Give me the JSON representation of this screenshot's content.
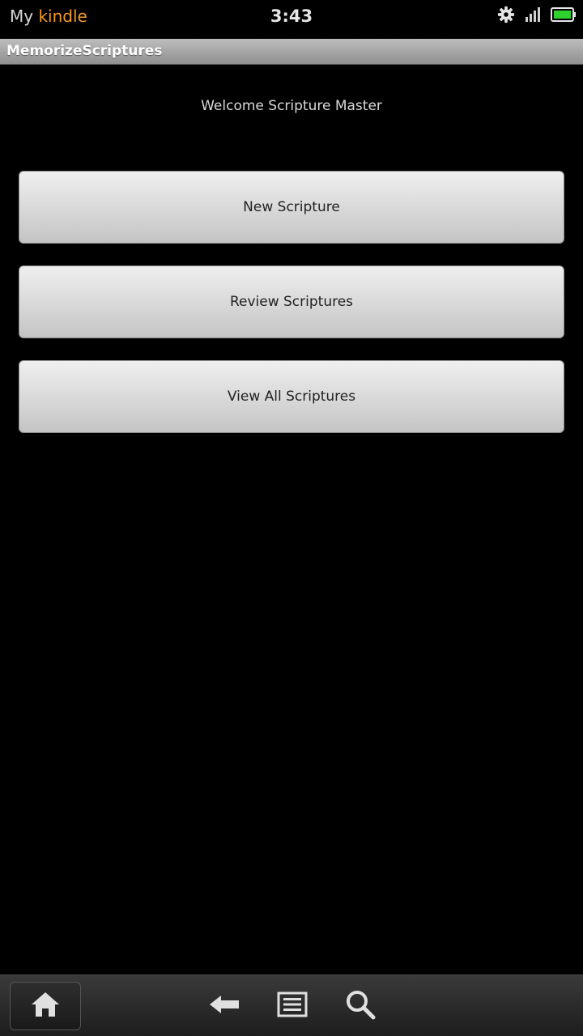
{
  "status_bar": {
    "brand_prefix": "My",
    "brand_name": "kindle",
    "time": "3:43",
    "icons": [
      "gear-icon",
      "signal-icon",
      "battery-icon"
    ],
    "battery_level": 1.0
  },
  "titlebar": {
    "title": "MemorizeScriptures"
  },
  "main": {
    "welcome": "Welcome Scripture Master",
    "buttons": [
      {
        "label": "New Scripture"
      },
      {
        "label": "Review Scriptures"
      },
      {
        "label": "View All Scriptures"
      }
    ]
  },
  "bottom_bar": {
    "icons": [
      "home-icon",
      "back-arrow-icon",
      "menu-icon",
      "search-icon"
    ]
  },
  "colors": {
    "background": "#000000",
    "kindle_orange": "#f39a1e",
    "battery_green": "#2fd12f"
  }
}
